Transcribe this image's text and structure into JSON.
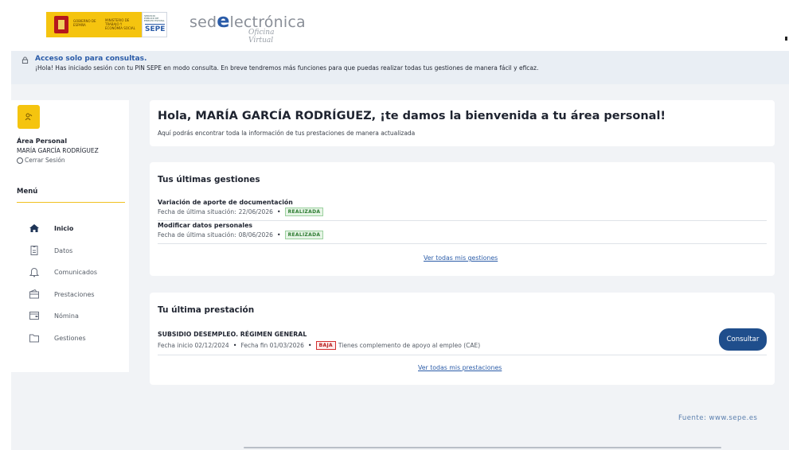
{
  "header": {
    "gov_line1": "GOBIERNO DE ESPAÑA",
    "gov_line2": "MINISTERIO DE TRABAJO Y ECONOMÍA SOCIAL",
    "sepe_small": "SERVICIO PÚBLICO DE EMPLEO ESTATAL",
    "sepe_label": "SEPE",
    "sede_prefix": "sed",
    "sede_e": "e",
    "sede_suffix": "lectrónica",
    "sede_sub": "Oficina Virtual"
  },
  "notice": {
    "title": "Acceso solo para consultas.",
    "body": "¡Hola! Has iniciado sesión con tu PIN SEPE en modo consulta. En breve tendremos más funciones para que puedas realizar todas tus gestiones de manera fácil y eficaz."
  },
  "sidebar": {
    "area_label": "Área Personal",
    "user_name": "MARÍA GARCÍA RODRÍGUEZ",
    "logout": "Cerrar Sesión",
    "menu_title": "Menú",
    "items": [
      {
        "label": "Inicio",
        "icon": "home-icon"
      },
      {
        "label": "Datos",
        "icon": "document-icon"
      },
      {
        "label": "Comunicados",
        "icon": "bell-icon"
      },
      {
        "label": "Prestaciones",
        "icon": "wallet-icon"
      },
      {
        "label": "Nómina",
        "icon": "card-icon"
      },
      {
        "label": "Gestiones",
        "icon": "folder-icon"
      }
    ]
  },
  "welcome": {
    "title": "Hola, MARÍA GARCÍA RODRÍGUEZ, ¡te damos la bienvenida a tu área personal!",
    "subtitle": "Aquí podrás encontrar toda la información de tus prestaciones de manera actualizada"
  },
  "gestiones": {
    "title": "Tus últimas gestiones",
    "items": [
      {
        "name": "Variación de aporte de documentación",
        "date_label": "Fecha de última situación:",
        "date": "22/06/2026",
        "status": "REALIZADA"
      },
      {
        "name": "Modificar datos personales",
        "date_label": "Fecha de última situación:",
        "date": "08/06/2026",
        "status": "REALIZADA"
      }
    ],
    "link": "Ver todas mis gestiones"
  },
  "prestacion": {
    "title": "Tu última prestación",
    "name": "SUBSIDIO DESEMPLEO. RÉGIMEN GENERAL",
    "start": "Fecha inicio 02/12/2024",
    "end": "Fecha fin 01/03/2026",
    "status": "BAJA",
    "note": "Tienes complemento de apoyo al empleo (CAE)",
    "button": "Consultar",
    "link": "Ver todas mis prestaciones"
  },
  "footer": {
    "source": "Fuente:  www.sepe.es"
  },
  "colors": {
    "accent_blue": "#2b5ca8",
    "button_blue": "#1f4e8c",
    "gov_yellow": "#f5c40f",
    "ok_green": "#2e7d32",
    "baja_red": "#b71c1c"
  }
}
